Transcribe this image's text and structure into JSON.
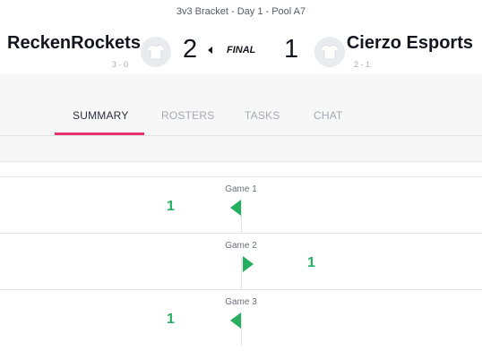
{
  "header": {
    "bracket_title": "3v3 Bracket - Day 1 - Pool A7",
    "status": "FINAL"
  },
  "team_left": {
    "name": "ReckenRockets",
    "record": "3 - 0",
    "score": "2"
  },
  "team_right": {
    "name": "Cierzo Esports",
    "record": "2 - 1",
    "score": "1"
  },
  "tabs": [
    {
      "label": "SUMMARY",
      "active": true
    },
    {
      "label": "ROSTERS",
      "active": false
    },
    {
      "label": "TASKS",
      "active": false
    },
    {
      "label": "CHAT",
      "active": false
    }
  ],
  "games": [
    {
      "label": "Game 1",
      "winner": "left",
      "win_value": "1"
    },
    {
      "label": "Game 2",
      "winner": "right",
      "win_value": "1"
    },
    {
      "label": "Game 3",
      "winner": "left",
      "win_value": "1"
    }
  ],
  "colors": {
    "accent": "#e8336b",
    "win": "#27ae60"
  },
  "icons": {
    "team_avatar": "jersey-icon",
    "winner_marker": "flag-icon",
    "score_indicator": "arrow-left-icon"
  }
}
